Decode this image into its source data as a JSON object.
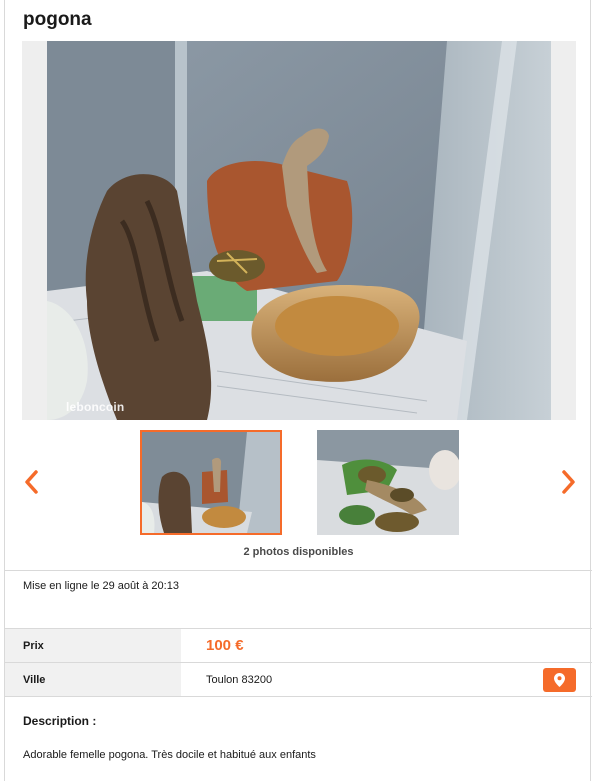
{
  "ad": {
    "title": "pogona",
    "watermark": "leboncoin",
    "photos_available": "2 photos disponibles",
    "posted": "Mise en ligne le 29 août à 20:13"
  },
  "details": {
    "price_label": "Prix",
    "price_value": "100 €",
    "city_label": "Ville",
    "city_value": "Toulon 83200"
  },
  "description": {
    "heading": "Description :",
    "text": "Adorable femelle pogona. Très docile et habitué aux enfants"
  },
  "icons": {
    "prev": "chevron-left-icon",
    "next": "chevron-right-icon",
    "map": "map-pin-icon"
  },
  "colors": {
    "accent": "#f56b2a",
    "label_bg": "#f1f1f1",
    "divider": "#d9d9d9"
  }
}
